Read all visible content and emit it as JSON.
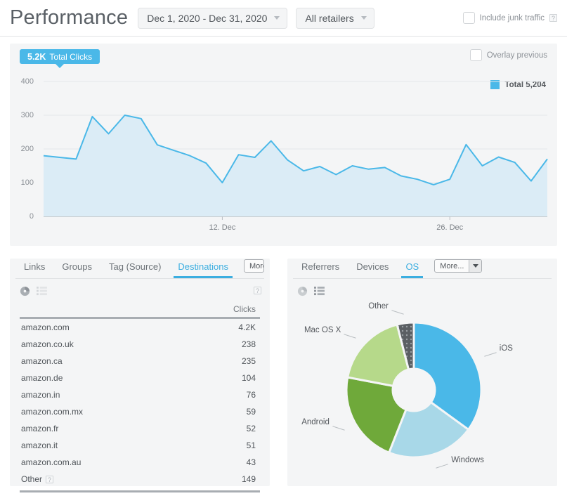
{
  "header": {
    "title": "Performance",
    "date_range": "Dec 1, 2020 - Dec 31, 2020",
    "retailer_filter": "All retailers",
    "junk_traffic_label": "Include junk traffic",
    "junk_traffic_help": "?",
    "caret": "chevron-down"
  },
  "chart_card": {
    "badge_value": "5.2K",
    "badge_label": "Total Clicks",
    "overlay_label": "Overlay previous",
    "legend_label": "Total 5,204",
    "legend_color": "#4ab8e8"
  },
  "chart_data": {
    "type": "area",
    "title": "Total Clicks",
    "xlabel": "",
    "ylabel": "",
    "ylim": [
      0,
      400
    ],
    "yticks": [
      0,
      100,
      200,
      300,
      400
    ],
    "xticks": [
      "12. Dec",
      "26. Dec"
    ],
    "xtick_index": [
      11,
      25
    ],
    "grid": true,
    "legend_position": "top-right",
    "series": [
      {
        "name": "Total",
        "total": 5204,
        "color": "#4ab8e8",
        "fill": "#dbecf6",
        "x": [
          "1. Dec",
          "2. Dec",
          "3. Dec",
          "4. Dec",
          "5. Dec",
          "6. Dec",
          "7. Dec",
          "8. Dec",
          "9. Dec",
          "10. Dec",
          "11. Dec",
          "12. Dec",
          "13. Dec",
          "14. Dec",
          "15. Dec",
          "16. Dec",
          "17. Dec",
          "18. Dec",
          "19. Dec",
          "20. Dec",
          "21. Dec",
          "22. Dec",
          "23. Dec",
          "24. Dec",
          "25. Dec",
          "26. Dec",
          "27. Dec",
          "28. Dec",
          "29. Dec",
          "30. Dec",
          "31. Dec"
        ],
        "values": [
          180,
          175,
          170,
          296,
          245,
          300,
          290,
          212,
          196,
          180,
          158,
          100,
          183,
          175,
          224,
          168,
          135,
          148,
          124,
          150,
          140,
          145,
          120,
          110,
          94,
          110,
          213,
          150,
          176,
          160,
          105,
          170
        ]
      }
    ]
  },
  "left_panel": {
    "tabs": [
      {
        "label": "Links",
        "active": false
      },
      {
        "label": "Groups",
        "active": false
      },
      {
        "label": "Tag (Source)",
        "active": false
      },
      {
        "label": "Destinations",
        "active": true
      }
    ],
    "more_label": "More...",
    "view_icons": [
      {
        "name": "pie-chart-icon",
        "active": true
      },
      {
        "name": "list-view-icon",
        "active": false
      }
    ],
    "help_icon": "?",
    "table": {
      "columns": [
        "",
        "Clicks"
      ],
      "rows": [
        {
          "label": "amazon.com",
          "value": "4.2K",
          "help": false
        },
        {
          "label": "amazon.co.uk",
          "value": "238",
          "help": false
        },
        {
          "label": "amazon.ca",
          "value": "235",
          "help": false
        },
        {
          "label": "amazon.de",
          "value": "104",
          "help": false
        },
        {
          "label": "amazon.in",
          "value": "76",
          "help": false
        },
        {
          "label": "amazon.com.mx",
          "value": "59",
          "help": false
        },
        {
          "label": "amazon.fr",
          "value": "52",
          "help": false
        },
        {
          "label": "amazon.it",
          "value": "51",
          "help": false
        },
        {
          "label": "amazon.com.au",
          "value": "43",
          "help": false
        },
        {
          "label": "Other",
          "value": "149",
          "help": true
        }
      ]
    }
  },
  "right_panel": {
    "tabs": [
      {
        "label": "Referrers",
        "active": false
      },
      {
        "label": "Devices",
        "active": false
      },
      {
        "label": "OS",
        "active": true
      }
    ],
    "more_label": "More...",
    "view_icons": [
      {
        "name": "pie-chart-icon",
        "active": false
      },
      {
        "name": "list-view-icon",
        "active": true
      }
    ],
    "pie": {
      "type": "pie",
      "title": "OS",
      "donut": true,
      "slices": [
        {
          "label": "iOS",
          "percent": 35,
          "color": "#4ab8e8"
        },
        {
          "label": "Windows",
          "percent": 21,
          "color": "#a8d8e8"
        },
        {
          "label": "Android",
          "percent": 22,
          "color": "#6fa93a"
        },
        {
          "label": "Mac OS X",
          "percent": 18,
          "color": "#b6d98a"
        },
        {
          "label": "Other",
          "percent": 4,
          "color": "#5a5f63"
        }
      ]
    }
  }
}
